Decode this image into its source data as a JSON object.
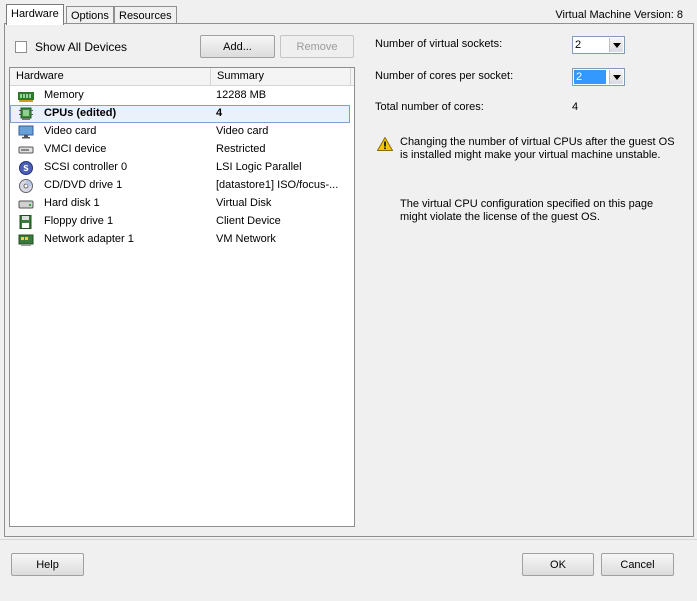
{
  "tabs": [
    {
      "label": "Hardware",
      "active": true
    },
    {
      "label": "Options",
      "active": false
    },
    {
      "label": "Resources",
      "active": false
    }
  ],
  "vm_version": "Virtual Machine Version: 8",
  "show_all_devices": {
    "label": "Show All Devices",
    "checked": false
  },
  "buttons": {
    "add": "Add...",
    "remove": "Remove",
    "help": "Help",
    "ok": "OK",
    "cancel": "Cancel"
  },
  "hardware_table": {
    "columns": [
      "Hardware",
      "Summary"
    ],
    "rows": [
      {
        "name": "Memory",
        "summary": "12288 MB",
        "icon": "memory-icon"
      },
      {
        "name": "CPUs (edited)",
        "summary": "4",
        "icon": "cpu-icon",
        "selected": true
      },
      {
        "name": "Video card",
        "summary": "Video card",
        "icon": "monitor-icon"
      },
      {
        "name": "VMCI device",
        "summary": "Restricted",
        "icon": "device-icon"
      },
      {
        "name": "SCSI controller 0",
        "summary": "LSI Logic Parallel",
        "icon": "scsi-icon"
      },
      {
        "name": "CD/DVD drive 1",
        "summary": "[datastore1] ISO/focus-...",
        "icon": "cd-icon"
      },
      {
        "name": "Hard disk 1",
        "summary": "Virtual Disk",
        "icon": "disk-icon"
      },
      {
        "name": "Floppy drive 1",
        "summary": "Client Device",
        "icon": "floppy-icon"
      },
      {
        "name": "Network adapter 1",
        "summary": "VM Network",
        "icon": "network-icon"
      }
    ]
  },
  "cpu_config": {
    "sockets_label": "Number of virtual sockets:",
    "sockets_value": "2",
    "cores_label": "Number of cores per socket:",
    "cores_value": "2",
    "total_label": "Total number of cores:",
    "total_value": "4",
    "warning_text": "Changing the number of virtual CPUs after the guest OS is installed might make your virtual machine unstable.",
    "license_text": "The virtual CPU configuration specified on this page might violate the license of the guest OS."
  },
  "colors": {
    "selection_border": "#7da2ce",
    "focus": "#3399ff",
    "warning": "#f5c400"
  }
}
